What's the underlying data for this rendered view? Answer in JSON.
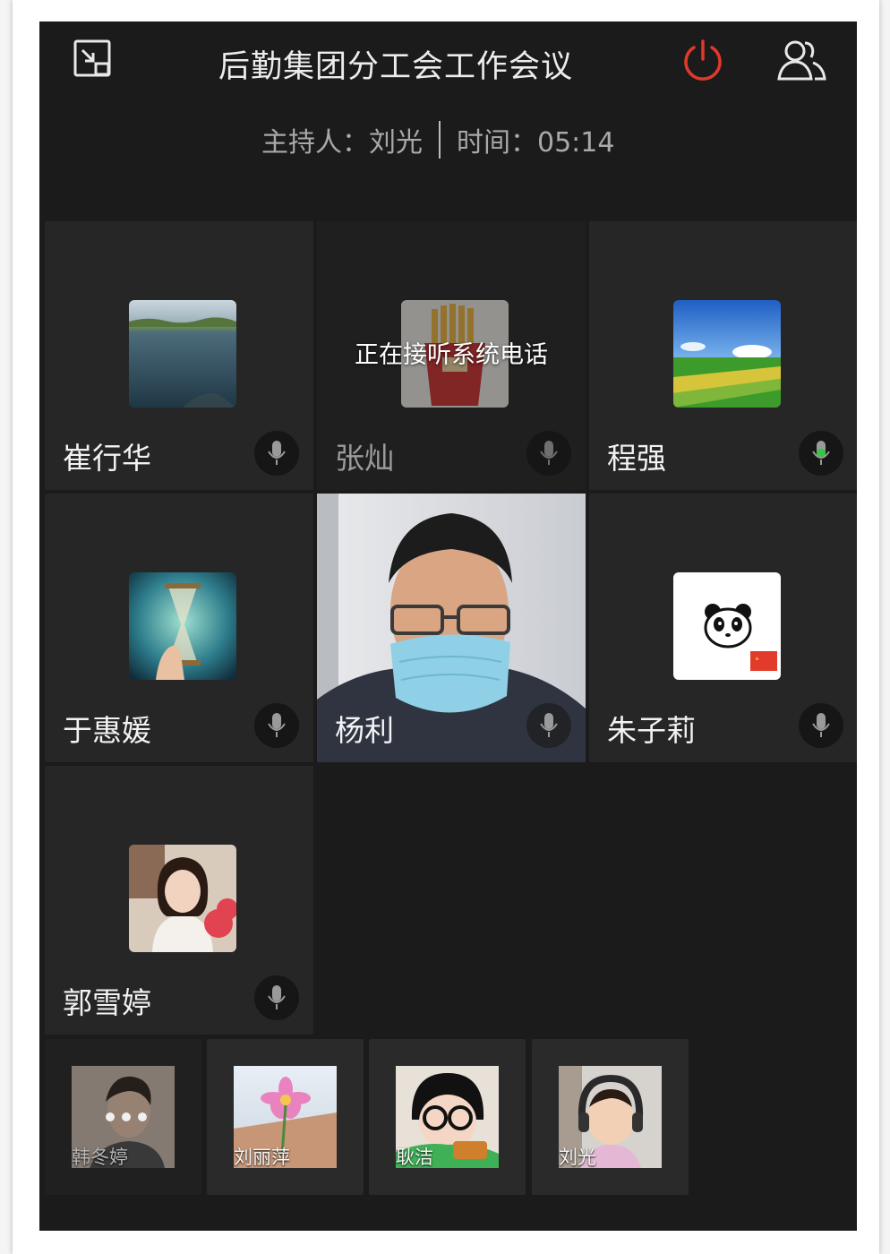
{
  "header": {
    "title": "后勤集团分工会工作会议",
    "host_label": "主持人：刘光",
    "time_label": "时间：05:14"
  },
  "tiles": [
    {
      "name": "崔行华",
      "mic": "idle"
    },
    {
      "name": "张灿",
      "mic": "idle",
      "overlay": "正在接听系统电话"
    },
    {
      "name": "程强",
      "mic": "active"
    },
    {
      "name": "于惠媛",
      "mic": "idle"
    },
    {
      "name": "杨利",
      "mic": "idle",
      "video": true
    },
    {
      "name": "朱子莉",
      "mic": "idle"
    },
    {
      "name": "郭雪婷",
      "mic": "idle"
    }
  ],
  "strip": [
    {
      "name": "韩冬婷",
      "state": "connecting"
    },
    {
      "name": "刘丽萍"
    },
    {
      "name": "耿洁"
    },
    {
      "name": "刘光"
    }
  ],
  "colors": {
    "background": "#1b1b1b",
    "tile": "#262626",
    "end_call": "#e0392b",
    "mic_active": "#3cc24a"
  }
}
